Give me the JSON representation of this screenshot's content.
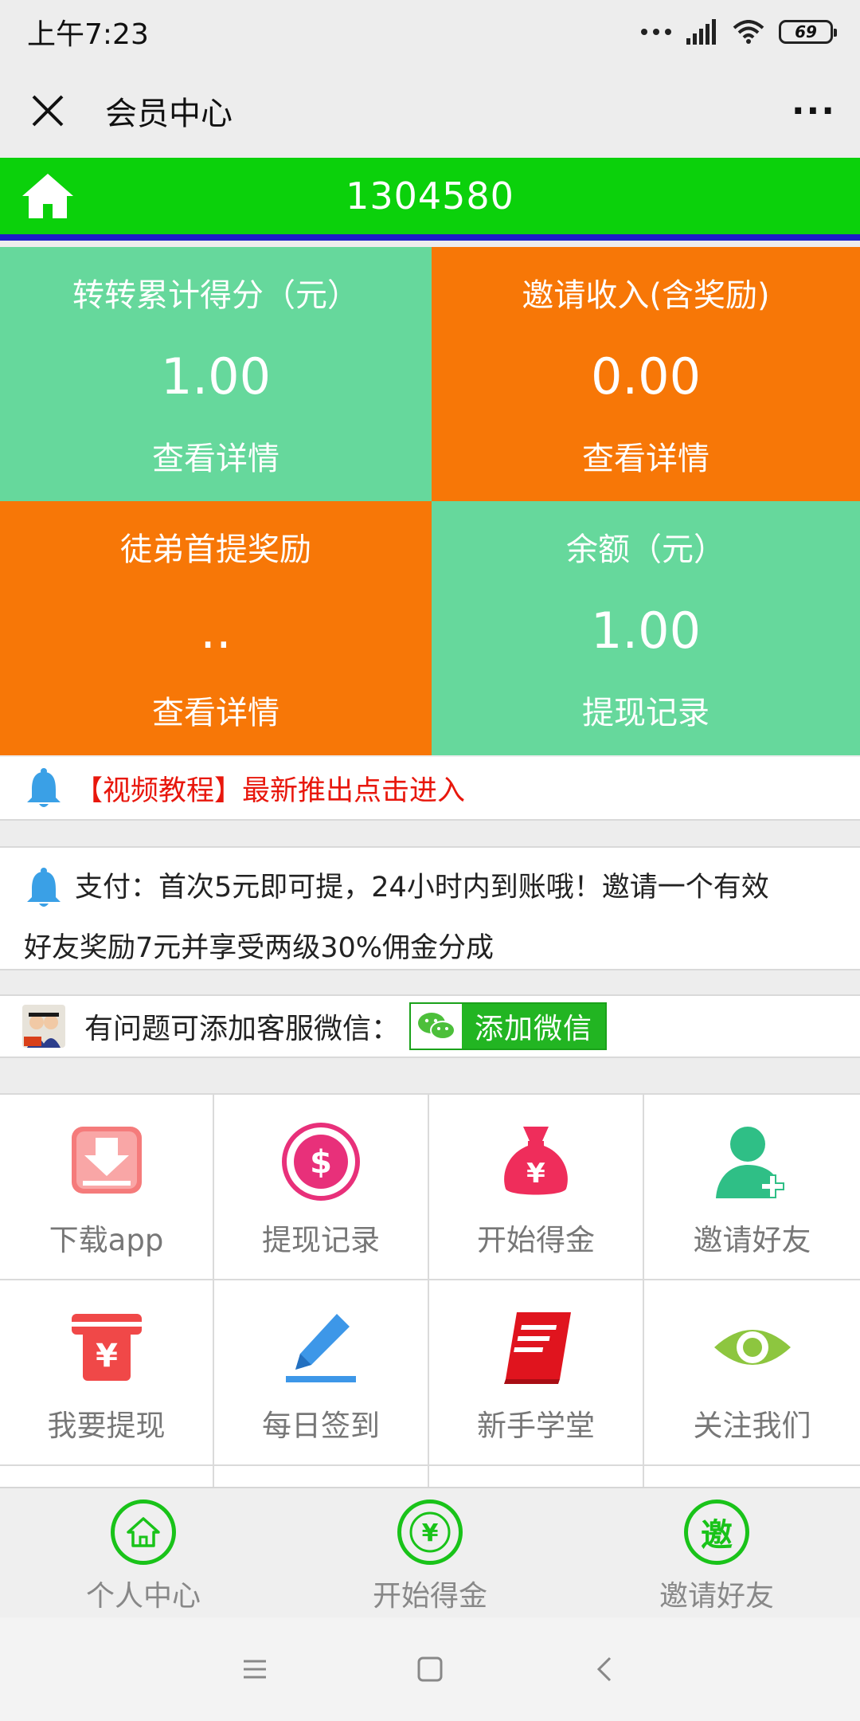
{
  "statusbar": {
    "time": "上午7:23",
    "battery": "69"
  },
  "titlebar": {
    "close_icon": "close-icon",
    "title": "会员中心",
    "more": "···"
  },
  "header": {
    "uid": "1304580",
    "home_icon": "home-icon"
  },
  "colors": {
    "green": "#0bd10b",
    "mint": "#66d89c",
    "orange": "#f77707",
    "red_text": "#e8170c",
    "blue_line": "#1b1ec8"
  },
  "stats": [
    {
      "label": "转转累计得分（元）",
      "value": "1.00",
      "link": "查看详情"
    },
    {
      "label": "邀请收入(含奖励)",
      "value": "0.00",
      "link": "查看详情"
    },
    {
      "label": "徒弟首提奖励",
      "value": "..",
      "link": "查看详情"
    },
    {
      "label": "余额（元）",
      "value": "1.00",
      "link": "提现记录"
    }
  ],
  "notice_video": "【视频教程】最新推出点击进入",
  "notice_pay": {
    "line1": "支付：首次5元即可提，24小时内到账哦！邀请一个有效",
    "line2": "好友奖励7元并享受两级30%佣金分成"
  },
  "service": {
    "text": "有问题可添加客服微信：",
    "button": "添加微信"
  },
  "menu": [
    {
      "label": "下载app",
      "icon": "download-icon"
    },
    {
      "label": "提现记录",
      "icon": "dollar-coin-icon"
    },
    {
      "label": "开始得金",
      "icon": "money-bag-icon"
    },
    {
      "label": "邀请好友",
      "icon": "add-user-icon"
    },
    {
      "label": "我要提现",
      "icon": "atm-withdraw-icon"
    },
    {
      "label": "每日签到",
      "icon": "pencil-icon"
    },
    {
      "label": "新手学堂",
      "icon": "book-icon"
    },
    {
      "label": "关注我们",
      "icon": "eye-icon"
    }
  ],
  "tabs": [
    {
      "label": "个人中心",
      "icon": "home-icon"
    },
    {
      "label": "开始得金",
      "icon": "yen-coin-icon"
    },
    {
      "label": "邀请好友",
      "icon": "invite-icon",
      "glyph": "邀"
    }
  ],
  "sysnav": {
    "menu_icon": "menu-icon",
    "home_icon": "square-home-icon",
    "back_icon": "back-icon"
  }
}
